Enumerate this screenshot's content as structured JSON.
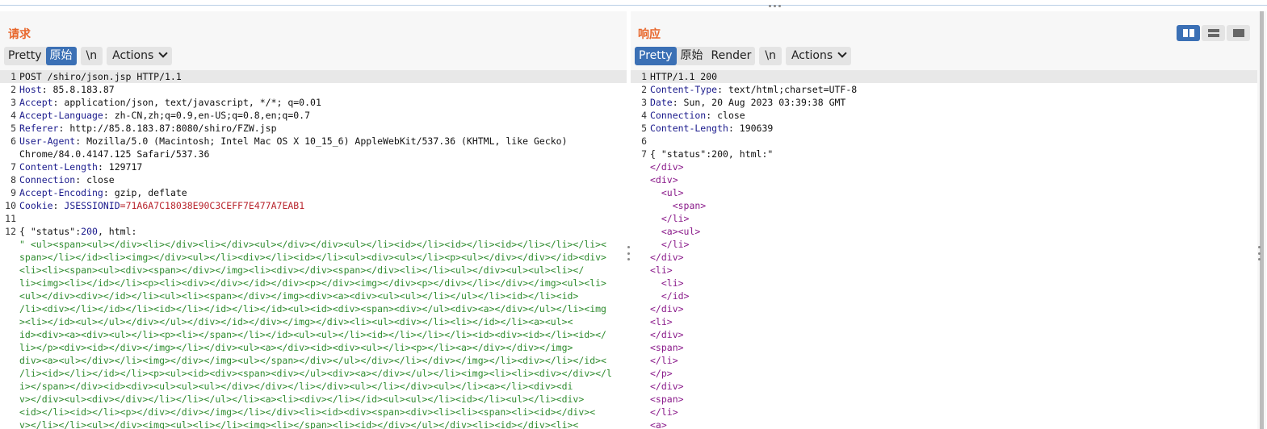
{
  "request": {
    "title": "请求",
    "tabs": [
      {
        "label": "Pretty",
        "active": false
      },
      {
        "label": "原始",
        "active": true
      }
    ],
    "newline_label": "\\n",
    "actions_label": "Actions",
    "lines": [
      {
        "n": "1",
        "parts": [
          {
            "t": "POST /shiro/json.jsp HTTP/1.1",
            "c": "v"
          }
        ],
        "hl": true
      },
      {
        "n": "2",
        "parts": [
          {
            "t": "Host",
            "c": "k"
          },
          {
            "t": ": 85.8.183.87",
            "c": "v"
          }
        ]
      },
      {
        "n": "3",
        "parts": [
          {
            "t": "Accept",
            "c": "k"
          },
          {
            "t": ": application/json, text/javascript, */*; q=0.01",
            "c": "v"
          }
        ]
      },
      {
        "n": "4",
        "parts": [
          {
            "t": "Accept-Language",
            "c": "k"
          },
          {
            "t": ": zh-CN,zh;q=0.9,en-US;q=0.8,en;q=0.7",
            "c": "v"
          }
        ]
      },
      {
        "n": "5",
        "parts": [
          {
            "t": "Referer",
            "c": "k"
          },
          {
            "t": ": http://85.8.183.87:8080/shiro/FZW.jsp",
            "c": "v"
          }
        ]
      },
      {
        "n": "6",
        "parts": [
          {
            "t": "User-Agent",
            "c": "k"
          },
          {
            "t": ": Mozilla/5.0 (Macintosh; Intel Mac OS X 10_15_6) AppleWebKit/537.36 (KHTML, like Gecko)",
            "c": "v"
          }
        ]
      },
      {
        "n": "",
        "parts": [
          {
            "t": "Chrome/84.0.4147.125 Safari/537.36",
            "c": "v"
          }
        ]
      },
      {
        "n": "7",
        "parts": [
          {
            "t": "Content-Length",
            "c": "k"
          },
          {
            "t": ": 129717",
            "c": "v"
          }
        ]
      },
      {
        "n": "8",
        "parts": [
          {
            "t": "Connection",
            "c": "k"
          },
          {
            "t": ": close",
            "c": "v"
          }
        ]
      },
      {
        "n": "9",
        "parts": [
          {
            "t": "Accept-Encoding",
            "c": "k"
          },
          {
            "t": ": gzip, deflate",
            "c": "v"
          }
        ]
      },
      {
        "n": "10",
        "parts": [
          {
            "t": "Cookie",
            "c": "k"
          },
          {
            "t": ": ",
            "c": "v"
          },
          {
            "t": "JSESSIONID",
            "c": "ck"
          },
          {
            "t": "=71A6A7C18038E90C3CEFF7E477A7EAB1",
            "c": "cv"
          }
        ]
      },
      {
        "n": "11",
        "parts": []
      },
      {
        "n": "12",
        "parts": [
          {
            "t": "{ \"status\":",
            "c": "v"
          },
          {
            "t": "200",
            "c": "num"
          },
          {
            "t": ", html:",
            "c": "v"
          }
        ]
      },
      {
        "n": "",
        "parts": [
          {
            "t": "\" <ul><span><ul></div><li></div><li></div><ul></div></div><ul></li><id></li><id></li><id></li></li></li><",
            "c": "g"
          }
        ]
      },
      {
        "n": "",
        "parts": [
          {
            "t": "span></li></id><li><img></div><ul></li><div></li><id></li><ul><div><ul></li><p><ul></div></div></id><div>",
            "c": "g"
          }
        ]
      },
      {
        "n": "",
        "parts": [
          {
            "t": "<li><li><span><ul><div><span></div></img><li><div></div><span></div><li></li><ul></div><ul><ul><li></",
            "c": "g"
          }
        ]
      },
      {
        "n": "",
        "parts": [
          {
            "t": "li><img><li></id></li><p><li><div></div></id></div><p></div><img></div><p></div></li></div></img><ul><li>",
            "c": "g"
          }
        ]
      },
      {
        "n": "",
        "parts": [
          {
            "t": "<ul></div><div></id></li><ul><li><span></div></img><div><a><div><ul><ul></li></ul></li><id></li><id>",
            "c": "g"
          }
        ]
      },
      {
        "n": "",
        "parts": [
          {
            "t": "/li><div></li></id></li><id></li></id></li></id><ul><id><div><span><div></ul><div><a></div></ul></li><img",
            "c": "g"
          }
        ]
      },
      {
        "n": "",
        "parts": [
          {
            "t": "><li></id><ul></ul></div></ul></div></id></div></img></div><li><ul><div></li><li></id></li><a><ul><",
            "c": "g"
          }
        ]
      },
      {
        "n": "",
        "parts": [
          {
            "t": "id><div><a><div><ul></li><p><li></span></li></id><ul><ul></li><id></li></li></li><id><div><id></li><id></",
            "c": "g"
          }
        ]
      },
      {
        "n": "",
        "parts": [
          {
            "t": "li></p><div><id></div></img></li></div><ul><a></div><id><div><ul></li><p></li><a></div></div></img>",
            "c": "g"
          }
        ]
      },
      {
        "n": "",
        "parts": [
          {
            "t": "div><a><ul></div></li><img></div></img><ul></span></div></ul></div></li></div></img></li><div></li></id><",
            "c": "g"
          }
        ]
      },
      {
        "n": "",
        "parts": [
          {
            "t": "/li><id></li></id></li><p><ul><id><div><span><div></ul><div><a></div></ul></li><img><li><li><div></div></l",
            "c": "g"
          }
        ]
      },
      {
        "n": "",
        "parts": [
          {
            "t": "i></span></div><id><div><ul><ul><ul></div></div></li></div><ul></li></div><ul></li><a></li><div><di",
            "c": "g"
          }
        ]
      },
      {
        "n": "",
        "parts": [
          {
            "t": "v></div><ul><div></div></li></li></ul></li><a><li><div></li></id><ul><ul></li><id></li><ul></li><div>",
            "c": "g"
          }
        ]
      },
      {
        "n": "",
        "parts": [
          {
            "t": "<id></li><id></li><p></div></div></img></li></div><li><id><div><span><div><li><li><span><li><id></div><",
            "c": "g"
          }
        ]
      },
      {
        "n": "",
        "parts": [
          {
            "t": "v></li></li><ul></div><img><ul><li></li><img><li></span><li><id></div></ul></div><li><id></div><li><",
            "c": "g"
          }
        ]
      }
    ]
  },
  "response": {
    "title": "响应",
    "tabs": [
      {
        "label": "Pretty",
        "active": true
      },
      {
        "label": "原始",
        "active": false
      },
      {
        "label": "Render",
        "active": false
      }
    ],
    "newline_label": "\\n",
    "actions_label": "Actions",
    "lines": [
      {
        "n": "1",
        "parts": [
          {
            "t": "HTTP/1.1 200",
            "c": "v"
          }
        ],
        "hl": true
      },
      {
        "n": "2",
        "parts": [
          {
            "t": "Content-Type",
            "c": "k"
          },
          {
            "t": ": text/html;charset=UTF-8",
            "c": "v"
          }
        ]
      },
      {
        "n": "3",
        "parts": [
          {
            "t": "Date",
            "c": "k"
          },
          {
            "t": ": Sun, 20 Aug 2023 03:39:38 GMT",
            "c": "v"
          }
        ]
      },
      {
        "n": "4",
        "parts": [
          {
            "t": "Connection",
            "c": "k"
          },
          {
            "t": ": close",
            "c": "v"
          }
        ]
      },
      {
        "n": "5",
        "parts": [
          {
            "t": "Content-Length",
            "c": "k"
          },
          {
            "t": ": 190639",
            "c": "v"
          }
        ]
      },
      {
        "n": "6",
        "parts": []
      },
      {
        "n": "7",
        "parts": [
          {
            "t": "{ \"status\":200, html:\"",
            "c": "v"
          }
        ]
      },
      {
        "n": "",
        "parts": [
          {
            "t": "</div>",
            "c": "tag"
          }
        ]
      },
      {
        "n": "",
        "parts": [
          {
            "t": "<div>",
            "c": "tag"
          }
        ]
      },
      {
        "n": "",
        "parts": [
          {
            "t": "  <ul>",
            "c": "tag"
          }
        ]
      },
      {
        "n": "",
        "parts": [
          {
            "t": "    <span>",
            "c": "tag"
          }
        ]
      },
      {
        "n": "",
        "parts": [
          {
            "t": "  </li>",
            "c": "tag"
          }
        ]
      },
      {
        "n": "",
        "parts": [
          {
            "t": "  <a><ul>",
            "c": "tag"
          }
        ]
      },
      {
        "n": "",
        "parts": [
          {
            "t": "  </li>",
            "c": "tag"
          }
        ]
      },
      {
        "n": "",
        "parts": [
          {
            "t": "</div>",
            "c": "tag"
          }
        ]
      },
      {
        "n": "",
        "parts": [
          {
            "t": "<li>",
            "c": "tag"
          }
        ]
      },
      {
        "n": "",
        "parts": [
          {
            "t": "  <li>",
            "c": "tag"
          }
        ]
      },
      {
        "n": "",
        "parts": [
          {
            "t": "  </id>",
            "c": "tag"
          }
        ]
      },
      {
        "n": "",
        "parts": [
          {
            "t": "</div>",
            "c": "tag"
          }
        ]
      },
      {
        "n": "",
        "parts": [
          {
            "t": "<li>",
            "c": "tag"
          }
        ]
      },
      {
        "n": "",
        "parts": [
          {
            "t": "</div>",
            "c": "tag"
          }
        ]
      },
      {
        "n": "",
        "parts": [
          {
            "t": "<span>",
            "c": "tag"
          }
        ]
      },
      {
        "n": "",
        "parts": [
          {
            "t": "</li>",
            "c": "tag"
          }
        ]
      },
      {
        "n": "",
        "parts": [
          {
            "t": "</p>",
            "c": "tag"
          }
        ]
      },
      {
        "n": "",
        "parts": [
          {
            "t": "</div>",
            "c": "tag"
          }
        ]
      },
      {
        "n": "",
        "parts": [
          {
            "t": "<span>",
            "c": "tag"
          }
        ]
      },
      {
        "n": "",
        "parts": [
          {
            "t": "</li>",
            "c": "tag"
          }
        ]
      },
      {
        "n": "",
        "parts": [
          {
            "t": "<a>",
            "c": "tag"
          }
        ]
      }
    ]
  },
  "layout_buttons": [
    {
      "name": "side-by-side",
      "active": true
    },
    {
      "name": "stacked",
      "active": false
    },
    {
      "name": "single",
      "active": false
    }
  ],
  "colors": {
    "accent": "#3b70b5",
    "title": "#e8672c",
    "header_key": "#1a1a8c",
    "cookie_value": "#b8252d",
    "body_text": "#2e8b2e",
    "tag": "#8a1a8a"
  }
}
